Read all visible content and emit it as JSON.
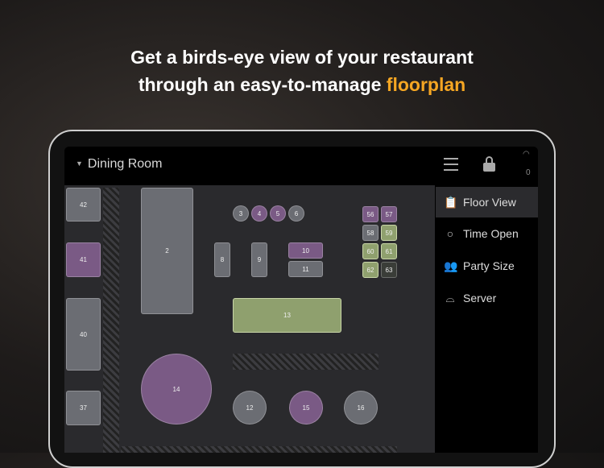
{
  "headline": {
    "line1": "Get a birds-eye view of your restaurant",
    "line2_prefix": "through an easy-to-manage ",
    "line2_highlight": "floorplan"
  },
  "header": {
    "room": "Dining Room",
    "online_count": "0"
  },
  "sidebar": {
    "items": [
      {
        "label": "Floor View",
        "active": true
      },
      {
        "label": "Time Open"
      },
      {
        "label": "Party Size"
      },
      {
        "label": "Server"
      }
    ]
  },
  "tables": {
    "t42": "42",
    "t41": "41",
    "t40": "40",
    "t37": "37",
    "t2": "2",
    "t3": "3",
    "t4": "4",
    "t5": "5",
    "t6": "6",
    "t8": "8",
    "t9": "9",
    "t10": "10",
    "t11": "11",
    "t56": "56",
    "t57": "57",
    "t58": "58",
    "t59": "59",
    "t60": "60",
    "t61": "61",
    "t62": "62",
    "t63": "63",
    "t13": "13",
    "t14": "14",
    "t12": "12",
    "t15": "15",
    "t16": "16"
  },
  "colors": {
    "accent": "#f5a623",
    "available": "#6b6d73",
    "seated": "#7a5a85",
    "ordered": "#8fa06e"
  }
}
